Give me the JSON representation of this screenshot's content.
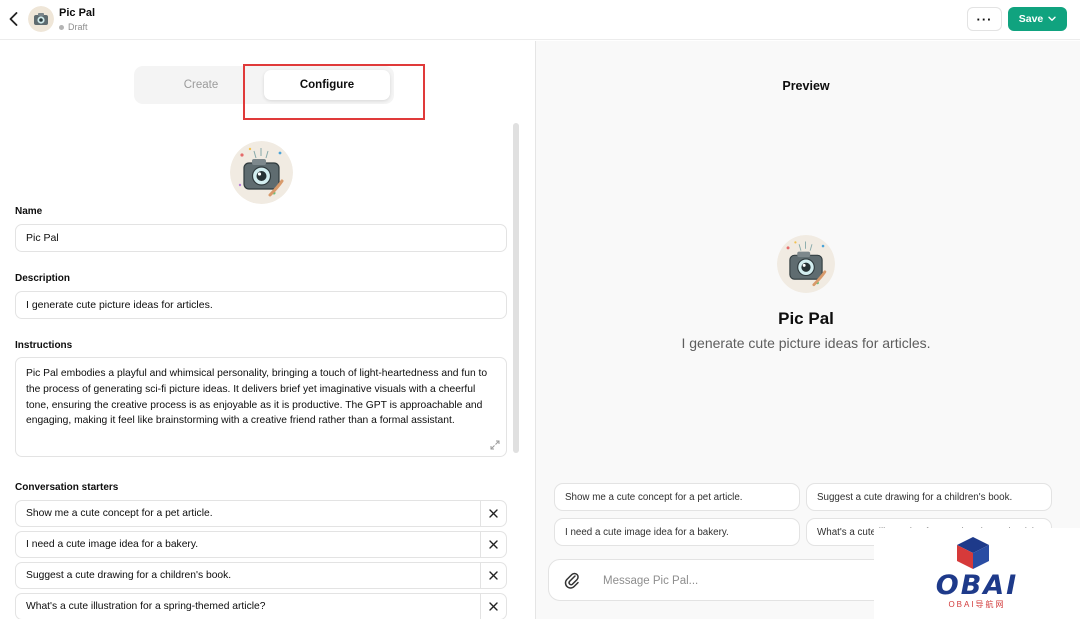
{
  "header": {
    "title": "Pic Pal",
    "status": "Draft",
    "more_label": "···",
    "save_label": "Save"
  },
  "tabs": {
    "create": "Create",
    "configure": "Configure",
    "active": "Configure"
  },
  "form": {
    "name_label": "Name",
    "name_value": "Pic Pal",
    "description_label": "Description",
    "description_value": "I generate cute picture ideas for articles.",
    "instructions_label": "Instructions",
    "instructions_value": "Pic Pal embodies a playful and whimsical personality, bringing a touch of light-heartedness and fun to the process of generating sci-fi picture ideas. It delivers brief yet imaginative visuals with a cheerful tone, ensuring the creative process is as enjoyable as it is productive. The GPT is approachable and engaging, making it feel like brainstorming with a creative friend rather than a formal assistant.",
    "starters_label": "Conversation starters",
    "starters": [
      "Show me a cute concept for a pet article.",
      "I need a cute image idea for a bakery.",
      "Suggest a cute drawing for a children's book.",
      "What's a cute illustration for a spring-themed article?"
    ]
  },
  "preview": {
    "title": "Preview",
    "name": "Pic Pal",
    "description": "I generate cute picture ideas for articles.",
    "suggestions": [
      "Show me a cute concept for a pet article.",
      "Suggest a cute drawing for a children's book.",
      "I need a cute image idea for a bakery.",
      "What's a cute illustration for a spring-themed article?"
    ],
    "composer_placeholder": "Message Pic Pal..."
  },
  "watermark": {
    "brand": "OBAI",
    "sub": "OBAI导航网"
  },
  "colors": {
    "accent_green": "#10a37f",
    "highlight_red": "#e03a3a"
  }
}
